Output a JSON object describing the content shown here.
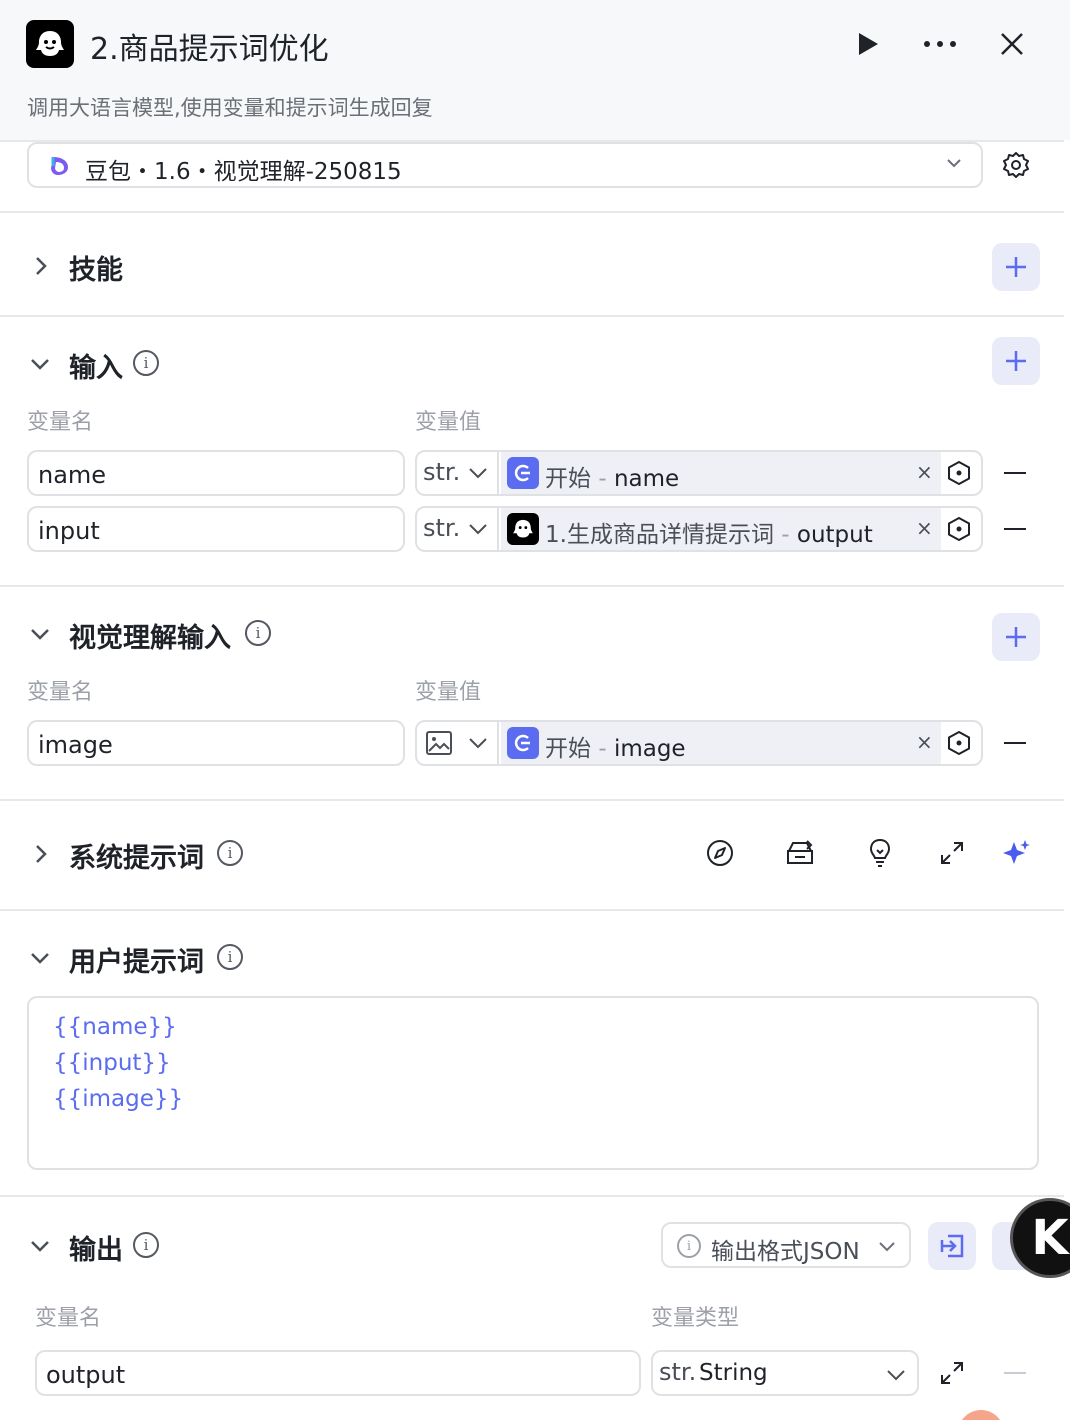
{
  "header": {
    "title": "2.商品提示词优化",
    "subtitle": "调用大语言模型,使用变量和提示词生成回复"
  },
  "model": {
    "label": "豆包・1.6・视觉理解-250815"
  },
  "sections": {
    "skills": "技能",
    "input": "输入",
    "vision_input": "视觉理解输入",
    "system_prompt": "系统提示词",
    "user_prompt": "用户提示词",
    "output": "输出"
  },
  "columns": {
    "var_name": "变量名",
    "var_value": "变量值",
    "var_type": "变量类型"
  },
  "inputs": [
    {
      "name": "name",
      "type": "str.",
      "node": "开始",
      "sep": "-",
      "field": "name",
      "clear": "×"
    },
    {
      "name": "input",
      "type": "str.",
      "node": "1.生成商品详情提示词",
      "sep": "-",
      "field": "output",
      "clear": "×"
    }
  ],
  "vision_inputs": [
    {
      "name": "image",
      "node": "开始",
      "sep": "-",
      "field": "image",
      "clear": "×"
    }
  ],
  "user_prompt_lines": [
    "{{name}}",
    "{{input}}",
    "{{image}}"
  ],
  "output": {
    "format_button": "输出格式JSON",
    "var_name": "output",
    "type_prefix": "str.",
    "type_name": "String",
    "avatar_letter": "K"
  },
  "colors": {
    "accent": "#5b6cf0",
    "header_bg": "#f7f8fa",
    "border": "#dfe1e5",
    "pill_bg": "#eef0f6"
  }
}
